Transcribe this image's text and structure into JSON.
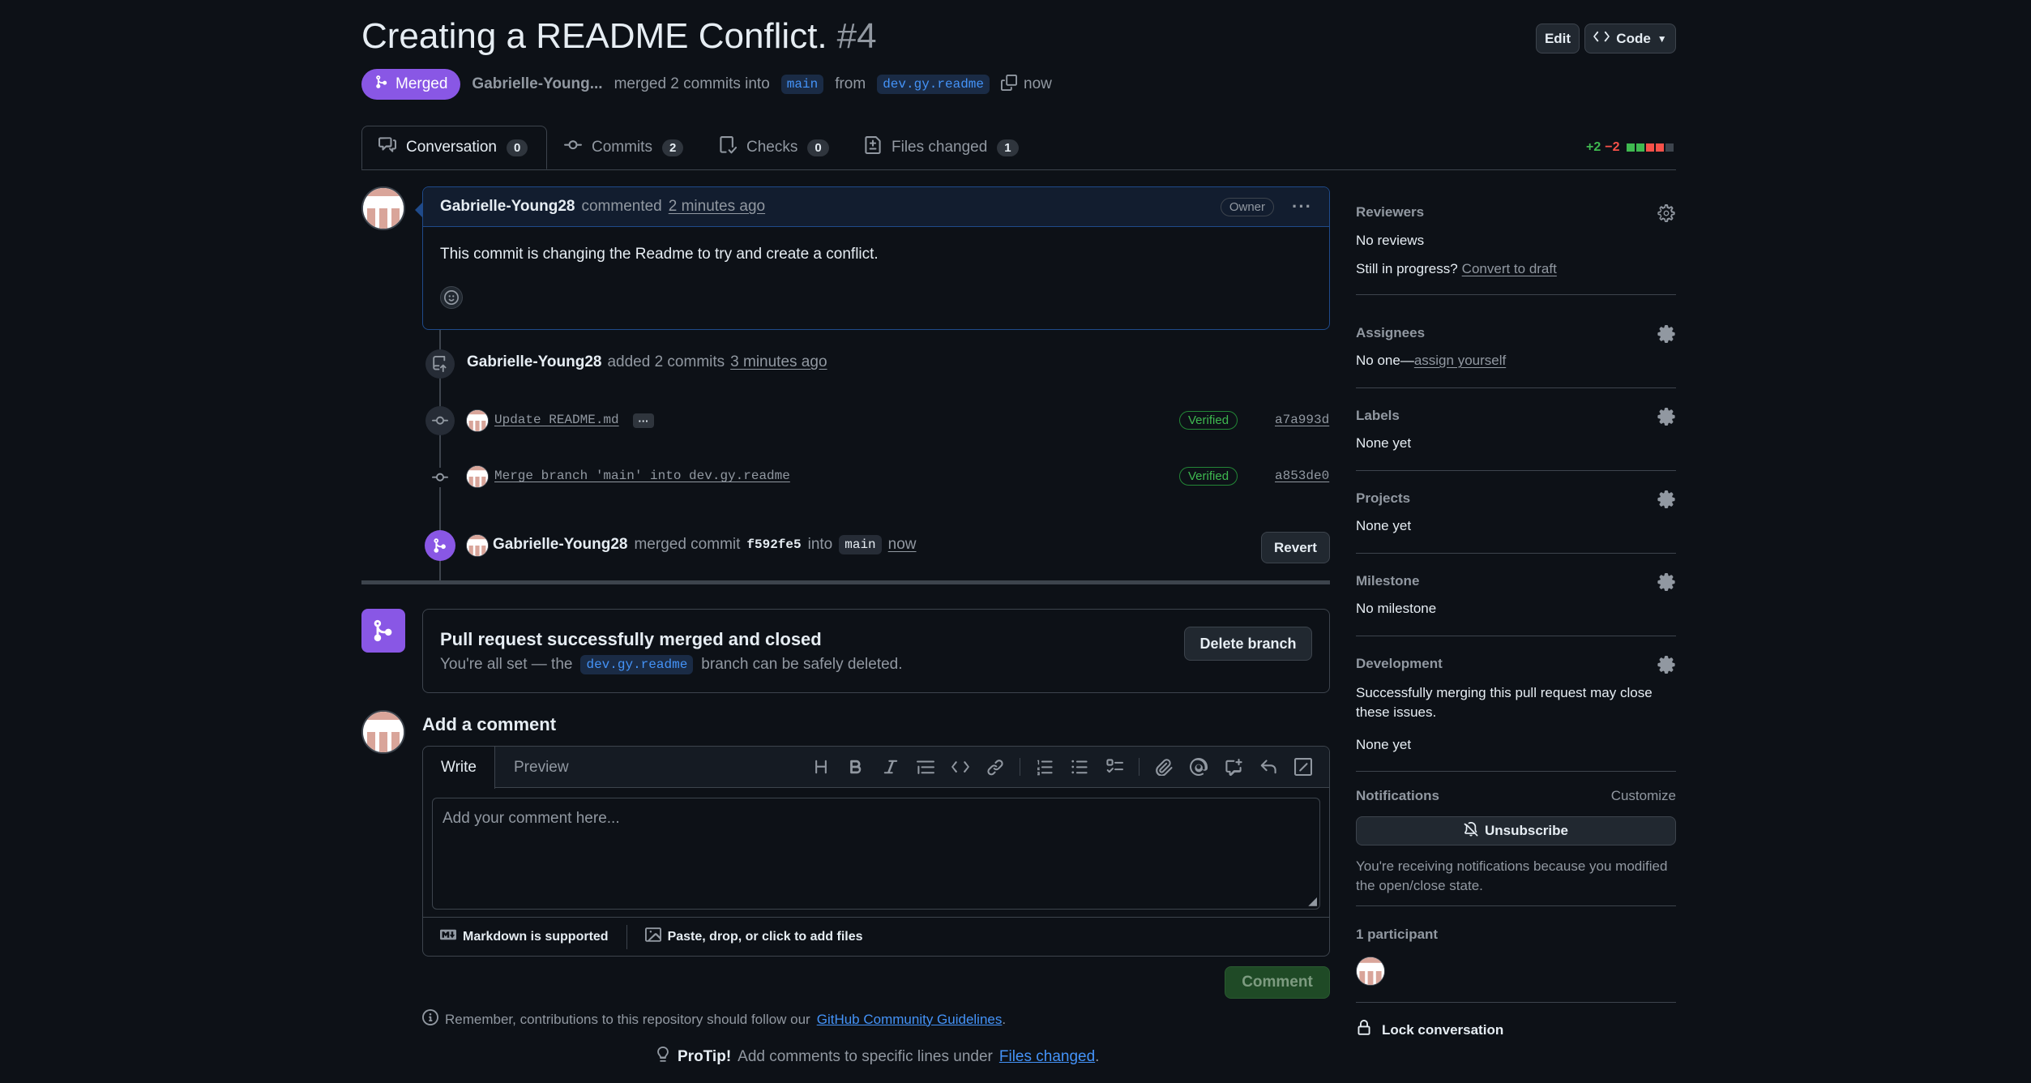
{
  "header": {
    "title": "Creating a README Conflict.",
    "number": "#4",
    "edit_label": "Edit",
    "code_label": "Code",
    "state_label": "Merged",
    "author": "Gabrielle-Young...",
    "merged_text": "merged 2 commits into",
    "base_branch": "main",
    "from_text": "from",
    "head_branch": "dev.gy.readme",
    "time": "now"
  },
  "tabs": [
    {
      "label": "Conversation",
      "count": "0"
    },
    {
      "label": "Commits",
      "count": "2"
    },
    {
      "label": "Checks",
      "count": "0"
    },
    {
      "label": "Files changed",
      "count": "1"
    }
  ],
  "diffstat": {
    "added": "+2",
    "removed": "−2"
  },
  "comment": {
    "author": "Gabrielle-Young28",
    "action": "commented",
    "time": "2 minutes ago",
    "badge": "Owner",
    "body": "This commit is changing the Readme to try and create a conflict."
  },
  "commits_event": {
    "author": "Gabrielle-Young28",
    "action": "added 2 commits",
    "time": "3 minutes ago",
    "commits": [
      {
        "message": "Update README.md",
        "status": "Verified",
        "sha": "a7a993d"
      },
      {
        "message": "Merge branch 'main' into dev.gy.readme",
        "status": "Verified",
        "sha": "a853de0"
      }
    ]
  },
  "merge_event": {
    "author": "Gabrielle-Young28",
    "action": "merged commit",
    "sha": "f592fe5",
    "into": "into",
    "branch": "main",
    "time": "now",
    "revert_label": "Revert"
  },
  "merged_box": {
    "title": "Pull request successfully merged and closed",
    "text_before": "You're all set — the",
    "branch": "dev.gy.readme",
    "text_after": "branch can be safely deleted.",
    "delete_label": "Delete branch"
  },
  "add_comment": {
    "heading": "Add a comment",
    "tab_write": "Write",
    "tab_preview": "Preview",
    "placeholder": "Add your comment here...",
    "markdown_label": "Markdown is supported",
    "files_label": "Paste, drop, or click to add files",
    "submit_label": "Comment"
  },
  "footer": {
    "guidelines_before": "Remember, contributions to this repository should follow our",
    "guidelines_link": "GitHub Community Guidelines",
    "protip_bold": "ProTip!",
    "protip_text": "Add comments to specific lines under",
    "protip_link": "Files changed"
  },
  "sidebar": {
    "reviewers": {
      "heading": "Reviewers",
      "value": "No reviews",
      "progress_text": "Still in progress?",
      "progress_link": "Convert to draft"
    },
    "assignees": {
      "heading": "Assignees",
      "value": "No one—",
      "link": "assign yourself"
    },
    "labels": {
      "heading": "Labels",
      "value": "None yet"
    },
    "projects": {
      "heading": "Projects",
      "value": "None yet"
    },
    "milestone": {
      "heading": "Milestone",
      "value": "No milestone"
    },
    "development": {
      "heading": "Development",
      "text": "Successfully merging this pull request may close these issues.",
      "value": "None yet"
    },
    "notifications": {
      "heading": "Notifications",
      "customize": "Customize",
      "unsubscribe": "Unsubscribe",
      "reason": "You're receiving notifications because you modified the open/close state."
    },
    "participants": {
      "heading": "1 participant"
    },
    "lock": "Lock conversation"
  },
  "colors": {
    "merged": "#8957e5",
    "verified": "#3fb950",
    "link": "#4493f8",
    "add": "#3fb950",
    "remove": "#f85149"
  }
}
